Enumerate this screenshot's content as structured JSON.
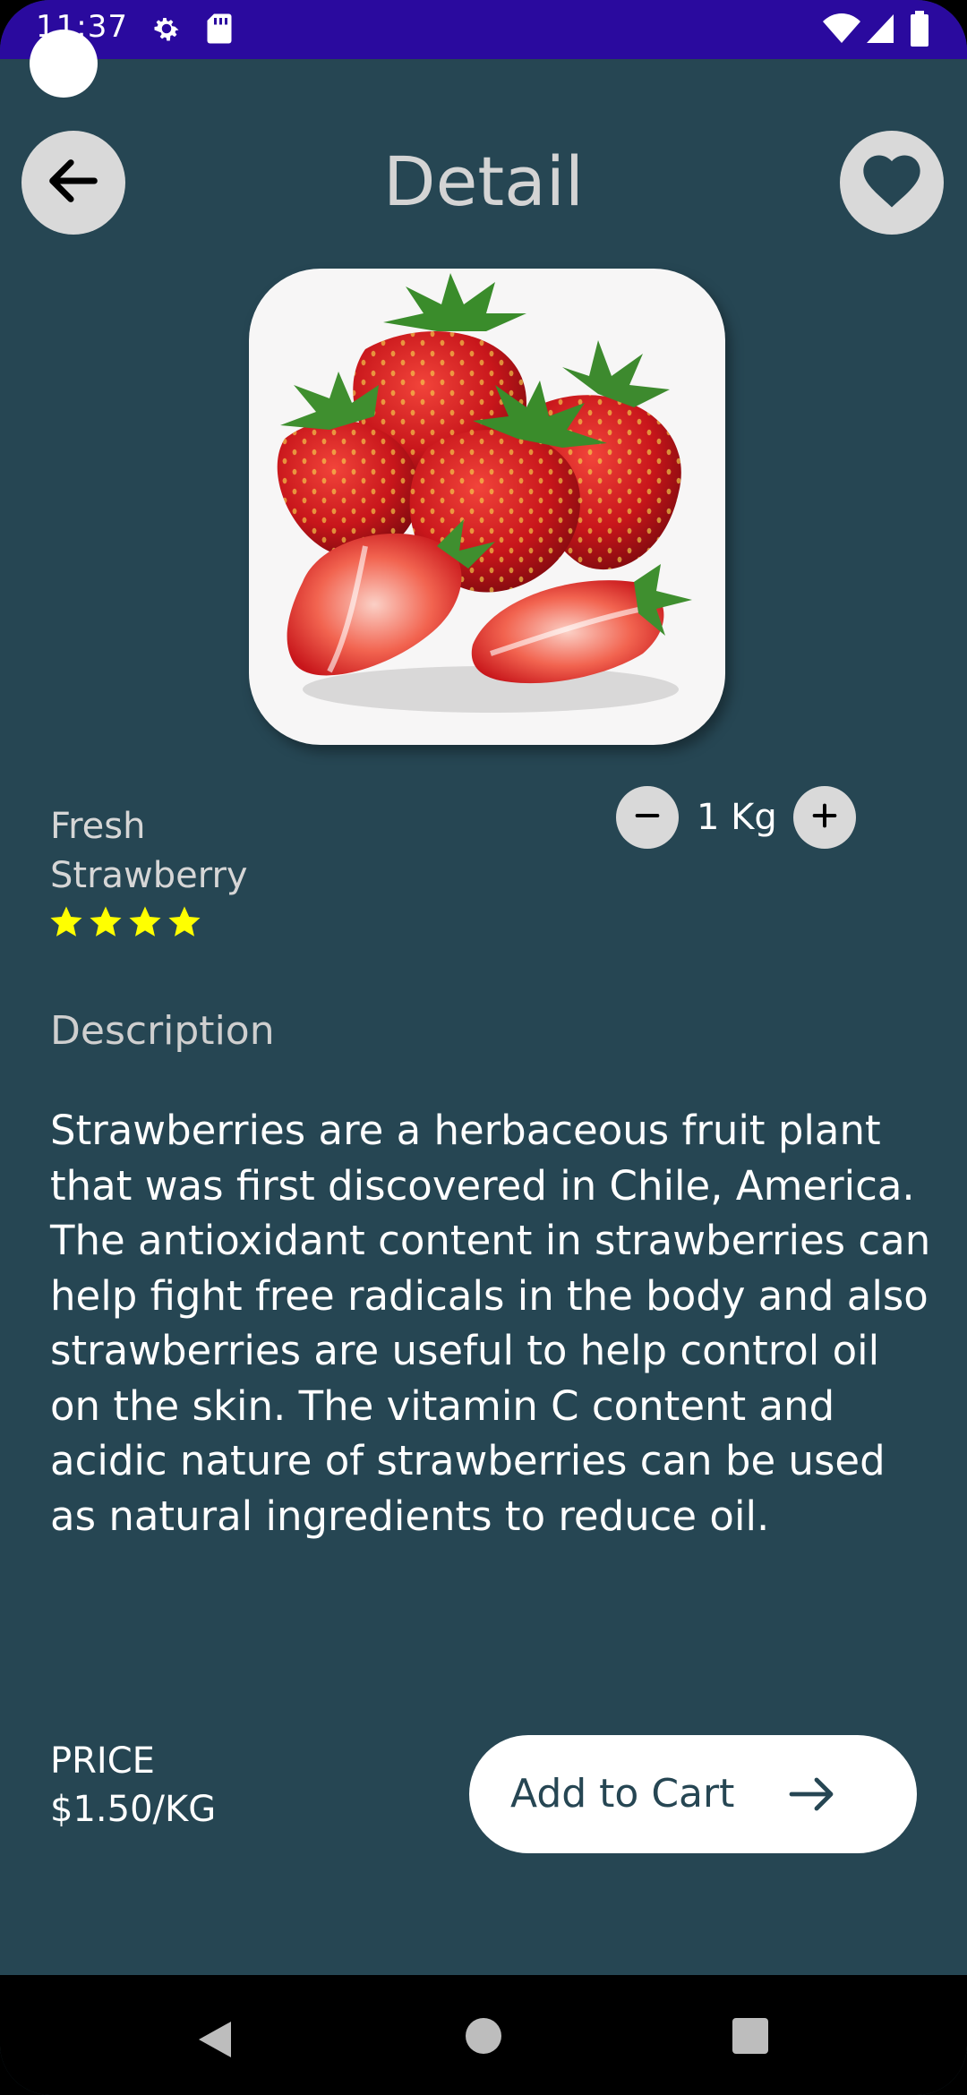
{
  "status_bar": {
    "time": "11:37",
    "icons": [
      "settings-icon",
      "sd-card-icon",
      "wifi-icon",
      "signal-icon",
      "battery-icon"
    ],
    "background": "#2a0a9e"
  },
  "header": {
    "title": "Detail",
    "back_icon": "arrow-left-icon",
    "favorite_icon": "heart-icon"
  },
  "product": {
    "image": "strawberries-image",
    "name_line1": "Fresh",
    "name_line2": "Strawberry",
    "rating": 4,
    "rating_max": 4,
    "star_color": "#ffff00",
    "quantity": "1 Kg"
  },
  "description": {
    "heading": "Description",
    "body": "Strawberries are a herbaceous fruit plant that was first discovered in Chile, America. The antioxidant content in strawberries can help fight free radicals in the body and also strawberries are useful to help control oil on the skin. The vitamin C content and acidic nature of strawberries can be used as natural ingredients to reduce oil."
  },
  "footer": {
    "price_label": "PRICE",
    "price_value": "$1.50/KG",
    "cart_label": "Add to Cart",
    "cart_icon": "arrow-right-icon"
  },
  "theme": {
    "background": "#264653",
    "button_grey": "#d9d9d9"
  },
  "nav_bar": {
    "items": [
      "back-nav-icon",
      "home-nav-icon",
      "recents-nav-icon"
    ]
  }
}
